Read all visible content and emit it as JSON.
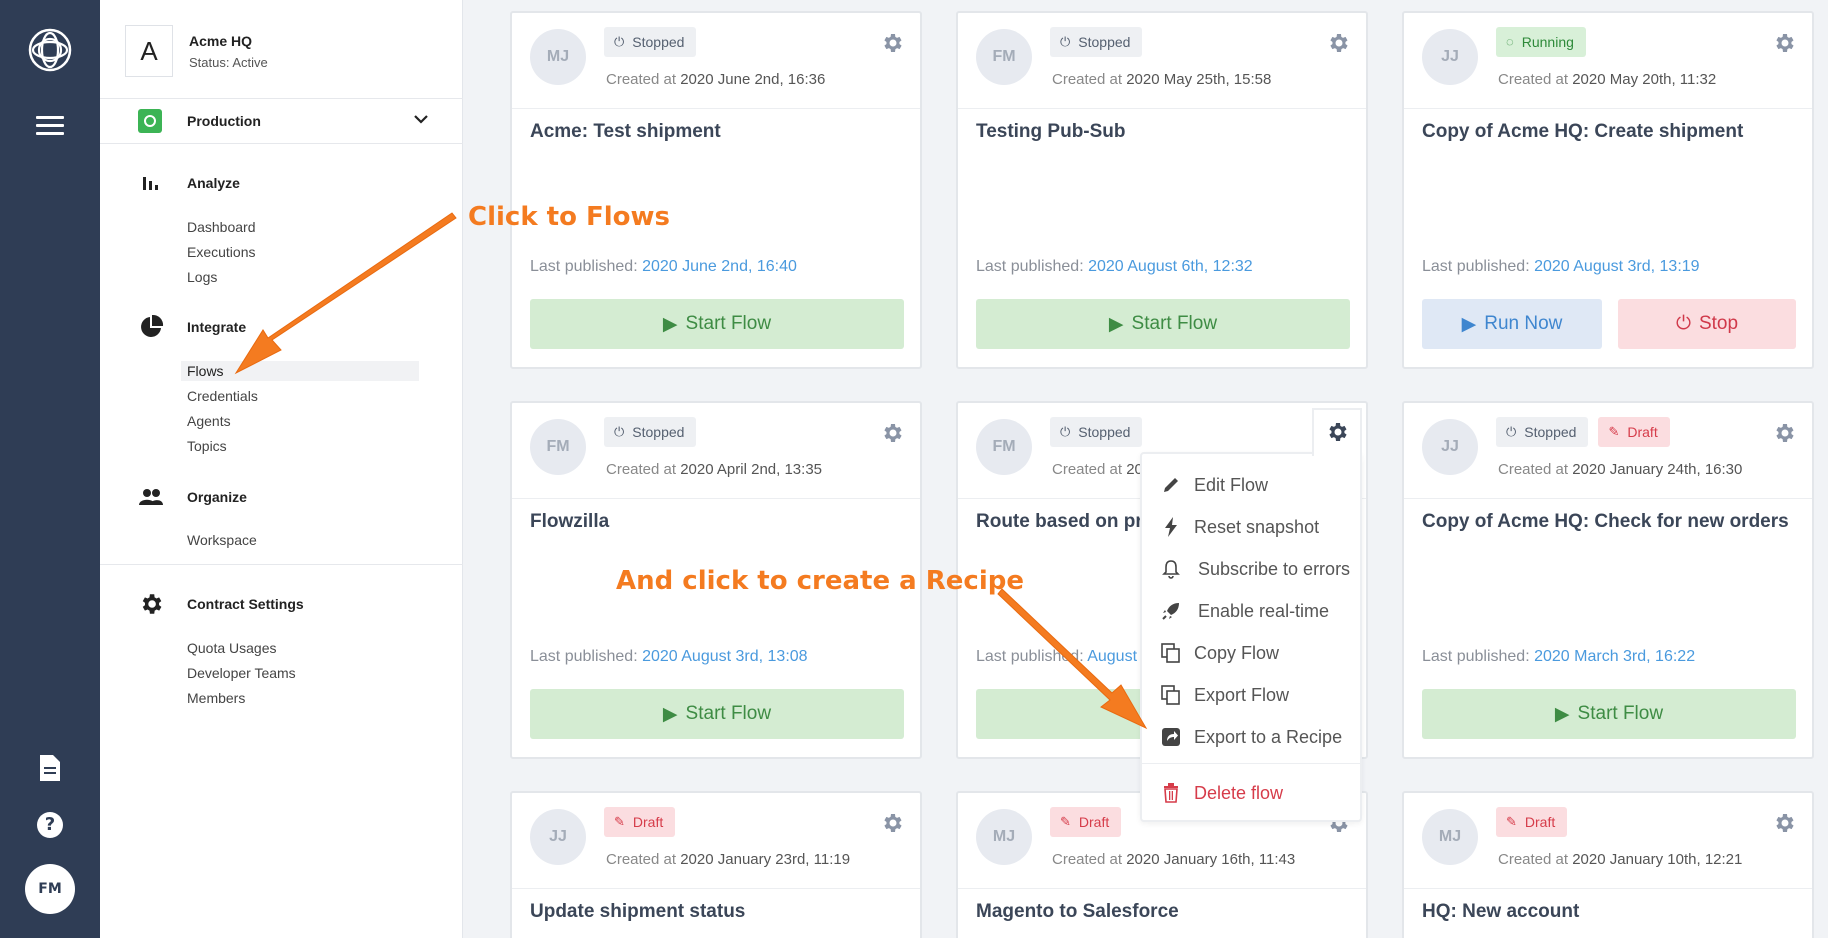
{
  "org": {
    "letter": "A",
    "name": "Acme HQ",
    "status": "Status: Active"
  },
  "environment": {
    "label": "Production"
  },
  "nav": {
    "analyze": {
      "label": "Analyze",
      "items": [
        "Dashboard",
        "Executions",
        "Logs"
      ]
    },
    "integrate": {
      "label": "Integrate",
      "items": [
        "Flows",
        "Credentials",
        "Agents",
        "Topics"
      ],
      "active": "Flows"
    },
    "organize": {
      "label": "Organize",
      "items": [
        "Workspace"
      ]
    },
    "contract": {
      "label": "Contract Settings",
      "items": [
        "Quota Usages",
        "Developer Teams",
        "Members"
      ]
    }
  },
  "user": {
    "initials": "FM"
  },
  "labels": {
    "created_at": "Created at",
    "last_published": "Last published:"
  },
  "cards": [
    {
      "initials": "MJ",
      "badges": [
        {
          "type": "stopped",
          "text": "Stopped"
        }
      ],
      "created": "2020 June 2nd, 16:36",
      "title": "Acme: Test shipment",
      "published": "2020 June 2nd, 16:40",
      "button": "Start Flow"
    },
    {
      "initials": "FM",
      "badges": [
        {
          "type": "stopped",
          "text": "Stopped"
        }
      ],
      "created": "2020 May 25th, 15:58",
      "title": "Testing Pub-Sub",
      "published": "2020 August 6th, 12:32",
      "button": "Start Flow"
    },
    {
      "initials": "JJ",
      "badges": [
        {
          "type": "running",
          "text": "Running"
        }
      ],
      "created": "2020 May 20th, 11:32",
      "title": "Copy of Acme HQ: Create shipment",
      "published": "2020 August 3rd, 13:19",
      "run_button": "Run Now",
      "stop_button": "Stop"
    },
    {
      "initials": "FM",
      "badges": [
        {
          "type": "stopped",
          "text": "Stopped"
        }
      ],
      "created": "2020 April 2nd, 13:35",
      "title": "Flowzilla",
      "published": "2020 August 3rd, 13:08",
      "button": "Start Flow"
    },
    {
      "initials": "FM",
      "badges": [
        {
          "type": "stopped",
          "text": "Stopped"
        }
      ],
      "created": "20",
      "title": "Route based on pr",
      "published": "August",
      "button": "S"
    },
    {
      "initials": "JJ",
      "badges": [
        {
          "type": "stopped",
          "text": "Stopped"
        },
        {
          "type": "draft",
          "text": "Draft"
        }
      ],
      "created": "2020 January 24th, 16:30",
      "title": "Copy of Acme HQ: Check for new orders",
      "published": "2020 March 3rd, 16:22",
      "button": "Start Flow"
    },
    {
      "initials": "JJ",
      "badges": [
        {
          "type": "draft",
          "text": "Draft"
        }
      ],
      "created": "2020 January 23rd, 11:19",
      "title": "Update shipment status"
    },
    {
      "initials": "MJ",
      "badges": [
        {
          "type": "draft",
          "text": "Draft"
        }
      ],
      "created": "2020 January 16th, 11:43",
      "title": "Magento to Salesforce"
    },
    {
      "initials": "MJ",
      "badges": [
        {
          "type": "draft",
          "text": "Draft"
        }
      ],
      "created": "2020 January 10th, 12:21",
      "title": "HQ: New account"
    }
  ],
  "menu": {
    "items": [
      "Edit Flow",
      "Reset snapshot",
      "Subscribe to errors",
      "Enable real-time",
      "Copy Flow",
      "Export Flow",
      "Export to a Recipe"
    ],
    "delete": "Delete flow"
  },
  "annotations": {
    "flows": "Click to Flows",
    "recipe": "And click to create a Recipe"
  },
  "colors": {
    "rail": "#2f3d55",
    "accent": "#f47b20",
    "link": "#4a9ade",
    "start_bg": "#d4ecd2",
    "stop_bg": "#fbdde0"
  }
}
